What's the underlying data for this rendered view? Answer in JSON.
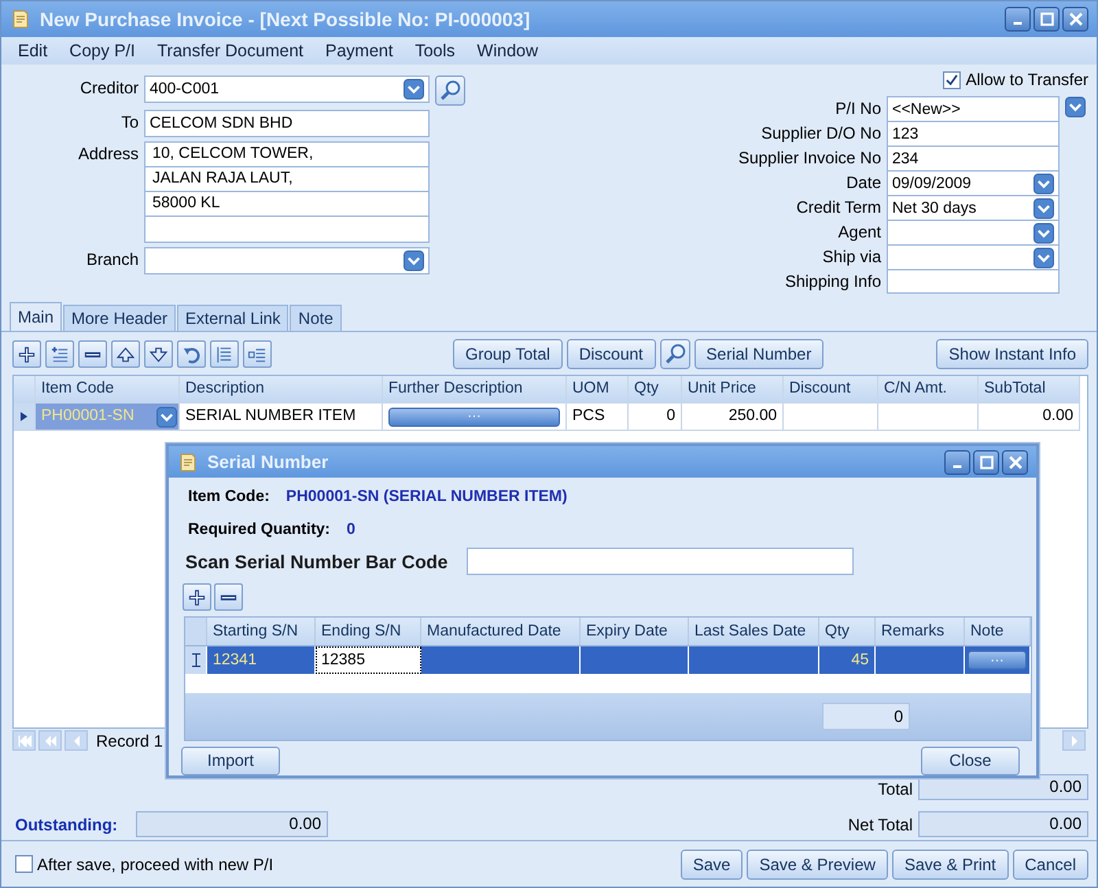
{
  "window": {
    "title": "New Purchase Invoice - [Next Possible No: PI-000003]"
  },
  "menu": [
    "Edit",
    "Copy P/I",
    "Transfer Document",
    "Payment",
    "Tools",
    "Window"
  ],
  "header": {
    "creditor": {
      "label": "Creditor",
      "value": "400-C001"
    },
    "to": {
      "label": "To",
      "value": "CELCOM SDN BHD"
    },
    "address": {
      "label": "Address",
      "lines": [
        "10, CELCOM TOWER,",
        "JALAN RAJA LAUT,",
        "58000 KL"
      ]
    },
    "branch": {
      "label": "Branch"
    },
    "allow_transfer": {
      "label": "Allow to Transfer",
      "checked": true
    },
    "fields": [
      {
        "label": "P/I  No",
        "value": "<<New>>",
        "kind": "combo"
      },
      {
        "label": "Supplier D/O No",
        "value": "123",
        "kind": "text"
      },
      {
        "label": "Supplier Invoice No",
        "value": "234",
        "kind": "text"
      },
      {
        "label": "Date",
        "value": "09/09/2009",
        "kind": "dropdown"
      },
      {
        "label": "Credit Term",
        "value": "Net 30 days",
        "kind": "dropdown"
      },
      {
        "label": "Agent",
        "kind": "dropdown"
      },
      {
        "label": "Ship via",
        "kind": "dropdown"
      },
      {
        "label": "Shipping Info",
        "kind": "text"
      }
    ]
  },
  "tabs": [
    {
      "label": "Main",
      "selected": true
    },
    {
      "label": "More Header",
      "selected": false
    },
    {
      "label": "External Link",
      "selected": false
    },
    {
      "label": "Note",
      "selected": false
    }
  ],
  "toolbar": {
    "buttons": [
      "Group Total",
      "Discount"
    ],
    "serial_button": "Serial Number",
    "info_button": "Show Instant Info"
  },
  "table": {
    "columns": [
      "Item Code",
      "Description",
      "Further Description",
      "UOM",
      "Qty",
      "Unit Price",
      "Discount",
      "C/N Amt.",
      "SubTotal"
    ],
    "rows": [
      {
        "selected": true,
        "item_code": "PH00001-SN",
        "description": "SERIAL NUMBER ITEM",
        "further_button": "···",
        "uom": "PCS",
        "qty": "0",
        "unit_price": "250.00",
        "subtotal": "0.00"
      }
    ]
  },
  "navigator": {
    "record": "Record 1"
  },
  "totals": {
    "total": {
      "label": "Total",
      "value": "0.00"
    },
    "outstanding": {
      "label": "Outstanding:",
      "value": "0.00"
    },
    "net_total": {
      "label": "Net Total",
      "value": "0.00"
    }
  },
  "footer": {
    "proceed": {
      "label": "After save, proceed with new P/I",
      "checked": false
    },
    "buttons": [
      "Save",
      "Save & Preview",
      "Save & Print",
      "Cancel"
    ]
  },
  "dialog": {
    "title": "Serial Number",
    "item_code": {
      "label": "Item Code:",
      "value": "PH00001-SN (SERIAL NUMBER ITEM)"
    },
    "required_quantity": {
      "label": "Required Quantity:",
      "value": "0"
    },
    "scan": {
      "label": "Scan Serial Number Bar Code"
    },
    "columns": [
      "Starting S/N",
      "Ending S/N",
      "Manufactured Date",
      "Expiry Date",
      "Last Sales Date",
      "Qty",
      "Remarks",
      "Note"
    ],
    "rows": [
      {
        "selected": true,
        "starting": "12341",
        "ending": "12385",
        "qty": "45",
        "note_button": "···"
      }
    ],
    "total_qty": "0",
    "buttons": [
      "Import",
      "Close"
    ]
  }
}
